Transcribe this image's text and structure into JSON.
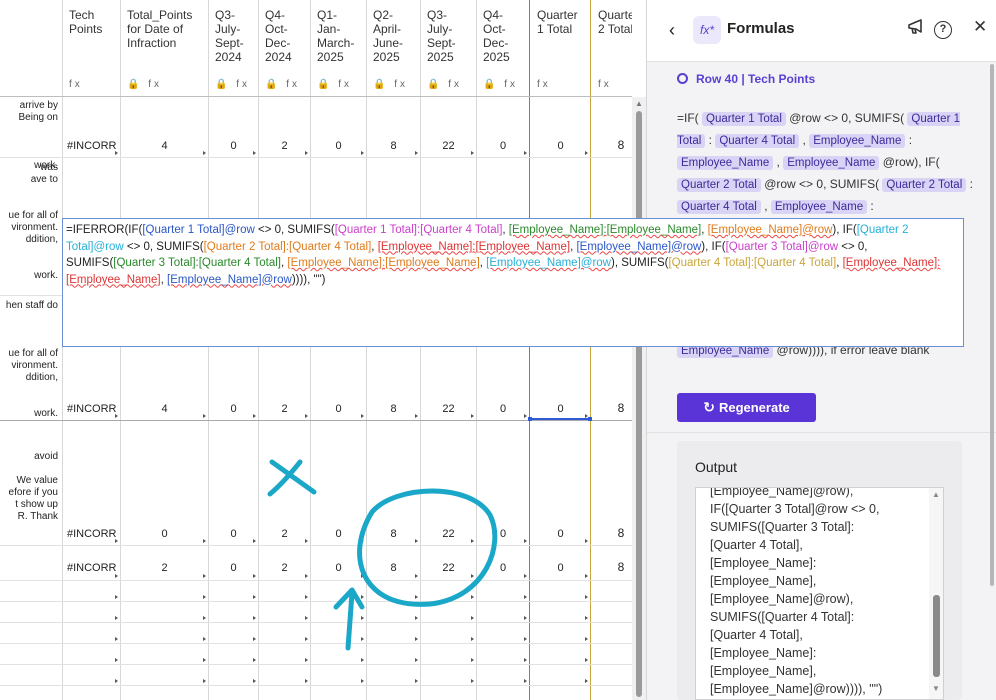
{
  "grid": {
    "headers": [
      {
        "label": "Tech\nPoints",
        "icons": "fx"
      },
      {
        "label": "Total_Points\nfor Date of\nInfraction",
        "icons": "🔒 fx"
      },
      {
        "label": "Q3-\nJuly-\nSept-\n2024",
        "icons": "🔒 fx"
      },
      {
        "label": "Q4-\nOct-\nDec-\n2024",
        "icons": "🔒 fx"
      },
      {
        "label": "Q1-\nJan-\nMarch-\n2025",
        "icons": "🔒 fx"
      },
      {
        "label": "Q2-\nApril-\nJune-\n2025",
        "icons": "🔒 fx"
      },
      {
        "label": "Q3-\nJuly-\nSept-\n2025",
        "icons": "🔒 fx"
      },
      {
        "label": "Q4-\nOct-\nDec-\n2025",
        "icons": "🔒 fx"
      },
      {
        "label": "Quarter\n1 Total",
        "icons": "fx"
      },
      {
        "label": "Quarter\n2 Total",
        "icons": "fx"
      }
    ],
    "snippets": [
      "arrive by\nBeing on\n\n\n\nwork.",
      "was\nave to\n\n\nue for all of\nvironment.\nddition,\n\n\nwork.",
      "hen staff do\n\n\n\nue for all of\nvironment.\nddition,\n\n\nwork.",
      "avoid\n\nWe value\nefore if you\nt show up\nR. Thank"
    ],
    "rows": [
      {
        "tech": "#INCORR",
        "total": "4",
        "q3_24": "0",
        "q4_24": "2",
        "q1_25": "0",
        "q2_25": "8",
        "q3_25": "22",
        "q4_25": "0",
        "qt1": "0",
        "qt2": "8"
      },
      {
        "tech": "#INCORR",
        "total": "4",
        "q3_24": "0",
        "q4_24": "2",
        "q1_25": "0",
        "q2_25": "8",
        "q3_25": "22",
        "q4_25": "0",
        "qt1": "0",
        "qt2": "8"
      },
      {
        "tech": "#INCORR",
        "total": "0",
        "q3_24": "0",
        "q4_24": "2",
        "q1_25": "0",
        "q2_25": "8",
        "q3_25": "22",
        "q4_25": "0",
        "qt1": "0",
        "qt2": "8"
      },
      {
        "tech": "#INCORR",
        "total": "2",
        "q3_24": "0",
        "q4_24": "2",
        "q1_25": "0",
        "q2_25": "8",
        "q3_25": "22",
        "q4_25": "0",
        "qt1": "0",
        "qt2": "8"
      }
    ]
  },
  "editor": {
    "segments": [
      {
        "t": "=IFERROR(IF(",
        "c": ""
      },
      {
        "t": "[Quarter 1 Total]@row",
        "c": "c1"
      },
      {
        "t": " <> 0, SUMIFS(",
        "c": ""
      },
      {
        "t": "[Quarter 1 Total]:[Quarter 4 Total]",
        "c": "c2"
      },
      {
        "t": ", ",
        "c": ""
      },
      {
        "t": "[Employee_Name]:[Employee_Name]",
        "c": "c3 u"
      },
      {
        "t": ", ",
        "c": ""
      },
      {
        "t": "[Employee_Name]@row",
        "c": "c4 u"
      },
      {
        "t": "), IF(",
        "c": ""
      },
      {
        "t": "[Quarter 2 Total]@row",
        "c": "c5"
      },
      {
        "t": " <> 0, SUMIFS(",
        "c": ""
      },
      {
        "t": "[Quarter 2 Total]:[Quarter 4 Total]",
        "c": "c4"
      },
      {
        "t": ", ",
        "c": ""
      },
      {
        "t": "[Employee_Name]:[Employee_Name]",
        "c": "c7 u"
      },
      {
        "t": ", ",
        "c": ""
      },
      {
        "t": "[Employee_Name]@row",
        "c": "c1 u"
      },
      {
        "t": "), IF(",
        "c": ""
      },
      {
        "t": "[Quarter 3 Total]@row",
        "c": "c2"
      },
      {
        "t": " <> 0, SUMIFS(",
        "c": ""
      },
      {
        "t": "[Quarter 3 Total]:[Quarter 4 Total]",
        "c": "c3"
      },
      {
        "t": ", ",
        "c": ""
      },
      {
        "t": "[Employee_Name]:[Employee_Name]",
        "c": "c4 u"
      },
      {
        "t": ", ",
        "c": ""
      },
      {
        "t": "[Employee_Name]@row",
        "c": "c5 u"
      },
      {
        "t": "), SUMIFS(",
        "c": ""
      },
      {
        "t": "[Quarter 4 Total]:[Quarter 4 Total]",
        "c": "c6"
      },
      {
        "t": ", ",
        "c": ""
      },
      {
        "t": "[Employee_Name]:[Employee_Name]",
        "c": "c7 u"
      },
      {
        "t": ", ",
        "c": ""
      },
      {
        "t": "[Employee_Name]@row",
        "c": "c1 u"
      },
      {
        "t": ")))), \"\")",
        "c": ""
      }
    ]
  },
  "panel": {
    "title": "Formulas",
    "logo": "fx*",
    "back": "‹",
    "row_context": "Row 40 | Tech Points",
    "formula_tail": "Employee_Name",
    "formula_tail_rest": " @row)))), if error leave blank",
    "regenerate_label": "Regenerate",
    "output_label": "Output",
    "output_text": "[Employee_Name]@row),\nIF([Quarter 3 Total]@row <> 0,\nSUMIFS([Quarter 3 Total]:\n[Quarter 4 Total],\n[Employee_Name]:\n[Employee_Name],\n[Employee_Name]@row),\nSUMIFS([Quarter 4 Total]:\n[Quarter 4 Total],\n[Employee_Name]:\n[Employee_Name],\n[Employee_Name]@row)))), \"\")"
  },
  "colors": {
    "accent": "#5a34d6",
    "annotation": "#1aa7c8",
    "chip_bg": "#d9d3f5"
  }
}
